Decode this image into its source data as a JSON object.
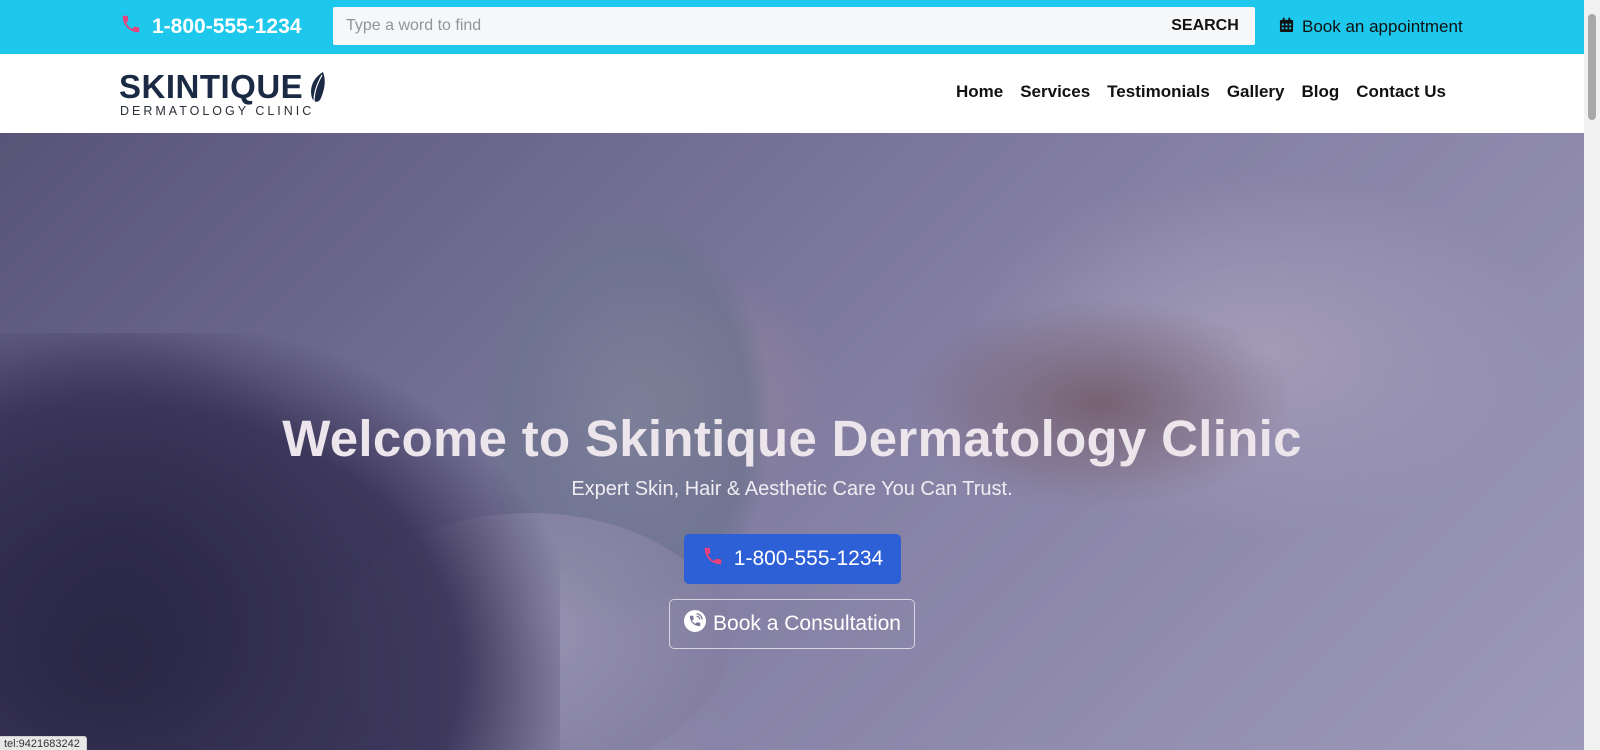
{
  "topbar": {
    "phone": "1-800-555-1234",
    "search_placeholder": "Type a word to find",
    "search_button": "SEARCH",
    "book_label": "Book an appointment"
  },
  "header": {
    "logo_main": "SKINTIQUE",
    "logo_sub": "DERMATOLOGY CLINIC",
    "nav": [
      "Home",
      "Services",
      "Testimonials",
      "Gallery",
      "Blog",
      "Contact Us"
    ]
  },
  "hero": {
    "title": "Welcome to Skintique Dermatology Clinic",
    "subtitle": "Expert Skin, Hair & Aesthetic Care You Can Trust.",
    "phone_button": "1-800-555-1234",
    "consult_button": "Book a Consultation"
  },
  "status_url": "tel:9421683242",
  "colors": {
    "topbar": "#1ec8ec",
    "phone_icon": "#e8427a",
    "primary_button": "#2d5fd6",
    "logo_text": "#1b2a44"
  },
  "icons": {
    "phone": "phone-icon",
    "calendar": "calendar-icon",
    "leaf": "leaf-icon",
    "phone_volume": "phone-volume-icon"
  }
}
